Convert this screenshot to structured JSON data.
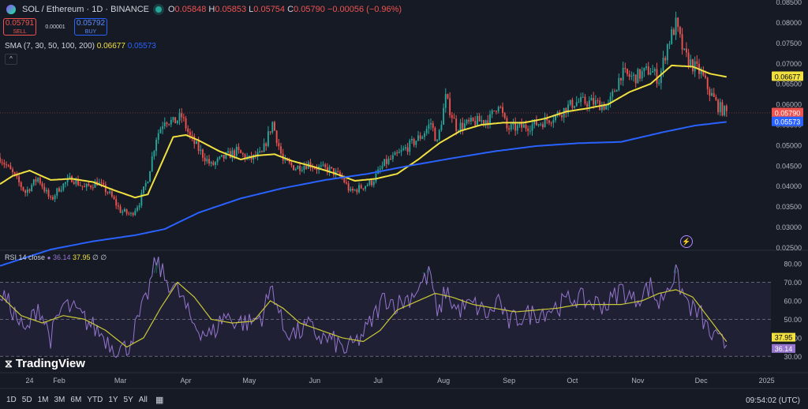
{
  "header": {
    "symbol": "SOL / Ethereum · 1D · BINANCE",
    "ohlc": [
      {
        "label": "O",
        "value": "0.05848"
      },
      {
        "label": "H",
        "value": "0.05853"
      },
      {
        "label": "L",
        "value": "0.05754"
      },
      {
        "label": "C",
        "value": "0.05790"
      },
      {
        "label": "",
        "value": "−0.00056 (−0.96%)"
      }
    ]
  },
  "trade": {
    "sell_price": "0.05791",
    "sell_label": "SELL",
    "spread": "0.00001",
    "buy_price": "0.05792",
    "buy_label": "BUY"
  },
  "sma_legend": {
    "label": "SMA (7, 30, 50, 100, 200)",
    "v1": "0.06677",
    "v2": "0.05573"
  },
  "rsi_legend": {
    "label": "RSI",
    "params": "14 close",
    "v1": "36.14",
    "v2": "37.95",
    "v3": "∅ ∅"
  },
  "brand": "TradingView",
  "timeframes": [
    "1D",
    "5D",
    "1M",
    "3M",
    "6M",
    "YTD",
    "1Y",
    "5Y",
    "All"
  ],
  "clock": "09:54:02 (UTC)",
  "colors": {
    "bg": "#161a25",
    "up": "#26a69a",
    "down": "#ef5350",
    "sma_short": "#f0e040",
    "sma_long": "#2962ff",
    "rsi": "#9575cd",
    "rsi_ma": "#c8c836"
  },
  "chart_data": {
    "type": "candlestick",
    "price_axis": {
      "range": [
        0.0245,
        0.0855
      ],
      "ticks": [
        "0.08500",
        "0.08000",
        "0.07500",
        "0.07000",
        "0.06500",
        "0.06000",
        "0.05500",
        "0.05000",
        "0.04500",
        "0.04000",
        "0.03500",
        "0.03000",
        "0.02500"
      ]
    },
    "price_labels": [
      {
        "value": 0.06677,
        "text": "0.06677",
        "color": "#f0e040"
      },
      {
        "value": 0.0579,
        "text": "0.05790",
        "color": "#ef5350"
      },
      {
        "value": 0.05573,
        "text": "0.05573",
        "color": "#2962ff"
      }
    ],
    "x_axis": {
      "labels": [
        {
          "text": "24",
          "day": 0
        },
        {
          "text": "Feb",
          "day": 14
        },
        {
          "text": "Mar",
          "day": 43
        },
        {
          "text": "Apr",
          "day": 74
        },
        {
          "text": "May",
          "day": 104
        },
        {
          "text": "Jun",
          "day": 135
        },
        {
          "text": "Jul",
          "day": 165
        },
        {
          "text": "Aug",
          "day": 196
        },
        {
          "text": "Sep",
          "day": 227
        },
        {
          "text": "Oct",
          "day": 257
        },
        {
          "text": "Nov",
          "day": 288
        },
        {
          "text": "Dec",
          "day": 318
        },
        {
          "text": "2025",
          "day": 349
        }
      ],
      "day_range": [
        -14,
        351
      ]
    },
    "close_anchors": [
      [
        -14,
        0.047
      ],
      [
        -8,
        0.043
      ],
      [
        -2,
        0.0385
      ],
      [
        4,
        0.042
      ],
      [
        10,
        0.0365
      ],
      [
        14,
        0.0395
      ],
      [
        20,
        0.042
      ],
      [
        26,
        0.0395
      ],
      [
        32,
        0.041
      ],
      [
        38,
        0.038
      ],
      [
        43,
        0.034
      ],
      [
        48,
        0.033
      ],
      [
        52,
        0.036
      ],
      [
        56,
        0.042
      ],
      [
        60,
        0.052
      ],
      [
        64,
        0.0565
      ],
      [
        68,
        0.0555
      ],
      [
        72,
        0.057
      ],
      [
        76,
        0.052
      ],
      [
        80,
        0.049
      ],
      [
        86,
        0.045
      ],
      [
        92,
        0.047
      ],
      [
        98,
        0.0485
      ],
      [
        104,
        0.0465
      ],
      [
        110,
        0.0478
      ],
      [
        115,
        0.0555
      ],
      [
        120,
        0.046
      ],
      [
        126,
        0.0445
      ],
      [
        132,
        0.0455
      ],
      [
        136,
        0.0445
      ],
      [
        142,
        0.044
      ],
      [
        148,
        0.042
      ],
      [
        152,
        0.0385
      ],
      [
        156,
        0.0395
      ],
      [
        162,
        0.041
      ],
      [
        168,
        0.0455
      ],
      [
        174,
        0.0475
      ],
      [
        180,
        0.05
      ],
      [
        186,
        0.0525
      ],
      [
        190,
        0.0555
      ],
      [
        193,
        0.0505
      ],
      [
        197,
        0.0615
      ],
      [
        202,
        0.0545
      ],
      [
        210,
        0.0555
      ],
      [
        218,
        0.0565
      ],
      [
        222,
        0.0605
      ],
      [
        226,
        0.054
      ],
      [
        234,
        0.0545
      ],
      [
        242,
        0.0555
      ],
      [
        250,
        0.0575
      ],
      [
        258,
        0.0605
      ],
      [
        266,
        0.0605
      ],
      [
        274,
        0.0595
      ],
      [
        280,
        0.0675
      ],
      [
        286,
        0.0665
      ],
      [
        294,
        0.0685
      ],
      [
        298,
        0.066
      ],
      [
        302,
        0.0745
      ],
      [
        306,
        0.0795
      ],
      [
        310,
        0.072
      ],
      [
        314,
        0.0695
      ],
      [
        318,
        0.0675
      ],
      [
        322,
        0.063
      ],
      [
        326,
        0.0595
      ],
      [
        330,
        0.0579
      ]
    ],
    "sma_short": {
      "color": "#f0e040",
      "points": [
        [
          -14,
          0.0405
        ],
        [
          -8,
          0.0425
        ],
        [
          0,
          0.0438
        ],
        [
          10,
          0.0415
        ],
        [
          20,
          0.0418
        ],
        [
          30,
          0.041
        ],
        [
          40,
          0.039
        ],
        [
          50,
          0.0372
        ],
        [
          56,
          0.038
        ],
        [
          62,
          0.045
        ],
        [
          68,
          0.052
        ],
        [
          74,
          0.0525
        ],
        [
          80,
          0.0512
        ],
        [
          90,
          0.0485
        ],
        [
          100,
          0.0465
        ],
        [
          108,
          0.0475
        ],
        [
          116,
          0.0478
        ],
        [
          124,
          0.0462
        ],
        [
          134,
          0.0448
        ],
        [
          144,
          0.0432
        ],
        [
          154,
          0.0413
        ],
        [
          164,
          0.0418
        ],
        [
          174,
          0.043
        ],
        [
          184,
          0.0465
        ],
        [
          194,
          0.0505
        ],
        [
          204,
          0.0535
        ],
        [
          214,
          0.055
        ],
        [
          224,
          0.0555
        ],
        [
          234,
          0.0555
        ],
        [
          244,
          0.0565
        ],
        [
          254,
          0.0582
        ],
        [
          264,
          0.059
        ],
        [
          274,
          0.06
        ],
        [
          284,
          0.063
        ],
        [
          294,
          0.065
        ],
        [
          304,
          0.0695
        ],
        [
          314,
          0.0692
        ],
        [
          322,
          0.0675
        ],
        [
          330,
          0.0667
        ]
      ]
    },
    "sma_long": {
      "color": "#2962ff",
      "points": [
        [
          -14,
          0.0205
        ],
        [
          10,
          0.0245
        ],
        [
          30,
          0.0265
        ],
        [
          50,
          0.028
        ],
        [
          64,
          0.0295
        ],
        [
          80,
          0.0335
        ],
        [
          100,
          0.037
        ],
        [
          120,
          0.0395
        ],
        [
          140,
          0.0415
        ],
        [
          160,
          0.043
        ],
        [
          180,
          0.045
        ],
        [
          200,
          0.0468
        ],
        [
          220,
          0.0485
        ],
        [
          240,
          0.0498
        ],
        [
          260,
          0.0505
        ],
        [
          280,
          0.0508
        ],
        [
          300,
          0.0532
        ],
        [
          315,
          0.0548
        ],
        [
          330,
          0.0557
        ]
      ]
    },
    "rsi": {
      "range": [
        22,
        86
      ],
      "ticks": [
        "80.00",
        "70.00",
        "60.00",
        "50.00",
        "40.00",
        "30.00"
      ],
      "band": [
        30,
        70
      ],
      "rsi_anchors": [
        [
          -14,
          65
        ],
        [
          -8,
          55
        ],
        [
          -2,
          42
        ],
        [
          4,
          58
        ],
        [
          10,
          40
        ],
        [
          16,
          58
        ],
        [
          22,
          54
        ],
        [
          28,
          48
        ],
        [
          34,
          42
        ],
        [
          40,
          35
        ],
        [
          46,
          34
        ],
        [
          50,
          45
        ],
        [
          55,
          60
        ],
        [
          60,
          82
        ],
        [
          64,
          72
        ],
        [
          68,
          68
        ],
        [
          72,
          62
        ],
        [
          76,
          50
        ],
        [
          80,
          45
        ],
        [
          86,
          41
        ],
        [
          92,
          52
        ],
        [
          98,
          49
        ],
        [
          104,
          48
        ],
        [
          110,
          52
        ],
        [
          115,
          68
        ],
        [
          120,
          45
        ],
        [
          126,
          42
        ],
        [
          132,
          46
        ],
        [
          138,
          40
        ],
        [
          144,
          38
        ],
        [
          150,
          33
        ],
        [
          155,
          38
        ],
        [
          160,
          45
        ],
        [
          168,
          62
        ],
        [
          174,
          58
        ],
        [
          180,
          62
        ],
        [
          186,
          70
        ],
        [
          190,
          75
        ],
        [
          193,
          50
        ],
        [
          197,
          66
        ],
        [
          202,
          55
        ],
        [
          210,
          58
        ],
        [
          218,
          52
        ],
        [
          222,
          62
        ],
        [
          226,
          48
        ],
        [
          234,
          52
        ],
        [
          242,
          54
        ],
        [
          250,
          57
        ],
        [
          258,
          62
        ],
        [
          266,
          59
        ],
        [
          274,
          58
        ],
        [
          280,
          67
        ],
        [
          286,
          60
        ],
        [
          294,
          68
        ],
        [
          298,
          58
        ],
        [
          302,
          68
        ],
        [
          306,
          74
        ],
        [
          310,
          62
        ],
        [
          314,
          55
        ],
        [
          318,
          52
        ],
        [
          322,
          42
        ],
        [
          326,
          38
        ],
        [
          330,
          36.14
        ]
      ],
      "ma_anchors": [
        [
          -14,
          63
        ],
        [
          -4,
          52
        ],
        [
          6,
          48
        ],
        [
          16,
          52
        ],
        [
          26,
          50
        ],
        [
          36,
          44
        ],
        [
          46,
          35
        ],
        [
          54,
          40
        ],
        [
          62,
          56
        ],
        [
          70,
          70
        ],
        [
          78,
          62
        ],
        [
          86,
          50
        ],
        [
          96,
          48
        ],
        [
          106,
          49
        ],
        [
          114,
          60
        ],
        [
          120,
          56
        ],
        [
          128,
          48
        ],
        [
          138,
          44
        ],
        [
          148,
          40
        ],
        [
          158,
          38
        ],
        [
          166,
          44
        ],
        [
          174,
          55
        ],
        [
          184,
          60
        ],
        [
          192,
          64
        ],
        [
          200,
          62
        ],
        [
          210,
          58
        ],
        [
          220,
          56
        ],
        [
          230,
          54
        ],
        [
          240,
          55
        ],
        [
          250,
          56
        ],
        [
          260,
          58
        ],
        [
          270,
          58
        ],
        [
          280,
          58
        ],
        [
          290,
          60
        ],
        [
          298,
          64
        ],
        [
          306,
          66
        ],
        [
          314,
          62
        ],
        [
          322,
          50
        ],
        [
          330,
          37.95
        ]
      ],
      "labels": [
        {
          "value": 37.95,
          "text": "37.95",
          "color": "#f0e040"
        },
        {
          "value": 36.14,
          "text": "36.14",
          "color": "#9575cd"
        }
      ]
    }
  }
}
